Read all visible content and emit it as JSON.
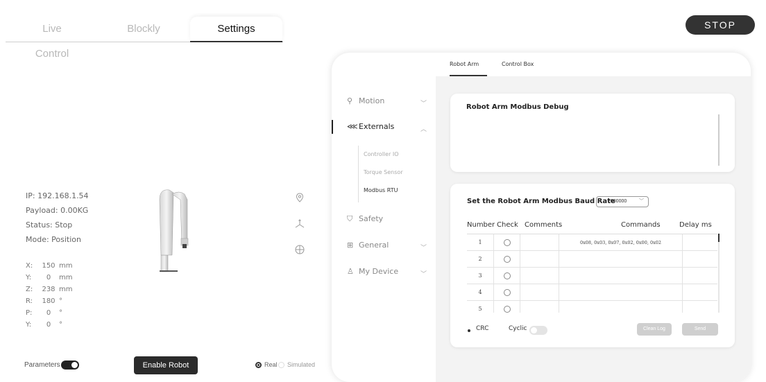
{
  "top_tabs": [
    {
      "label": "Live Control"
    },
    {
      "label": "Blockly"
    },
    {
      "label": "Settings"
    }
  ],
  "stop_label": "STOP",
  "robot_info": {
    "ip": "IP: 192.168.1.54",
    "payload": "Payload: 0.00KG",
    "status": "Status: Stop",
    "mode": "Mode: Position"
  },
  "coords": [
    {
      "axis": "X:",
      "value": "150",
      "unit": "mm"
    },
    {
      "axis": "Y:",
      "value": "0",
      "unit": "mm"
    },
    {
      "axis": "Z:",
      "value": "238",
      "unit": "mm"
    },
    {
      "axis": "R:",
      "value": "180",
      "unit": "°"
    },
    {
      "axis": "P:",
      "value": "0",
      "unit": "°"
    },
    {
      "axis": "Y:",
      "value": "0",
      "unit": "°"
    }
  ],
  "parameters_label": "Parameters",
  "enable_robot_label": "Enable Robot",
  "mode_options": {
    "real": "Real",
    "simulated": "Simulated"
  },
  "settings": {
    "sub_tabs": [
      {
        "label": "Robot Arm"
      },
      {
        "label": "Control Box"
      }
    ],
    "nav": [
      {
        "label": "Motion"
      },
      {
        "label": "Externals"
      },
      {
        "label": "Safety"
      },
      {
        "label": "General"
      },
      {
        "label": "My Device"
      }
    ],
    "externals_sub": [
      {
        "label": "Controller IO"
      },
      {
        "label": "Torque Sensor"
      },
      {
        "label": "Modbus RTU"
      }
    ]
  },
  "debug_panel": {
    "title": "Robot Arm Modbus Debug"
  },
  "baud_panel": {
    "title": "Set the Robot Arm Modbus Baud Rate",
    "baud_value": "2000000",
    "headers": {
      "number": "Number",
      "check": "Check",
      "comments": "Comments",
      "commands": "Commands",
      "delay": "Delay ms"
    },
    "rows": [
      {
        "number": "1",
        "command": "0x08, 0x03, 0x07, 0x02, 0x00, 0x02"
      },
      {
        "number": "2",
        "command": ""
      },
      {
        "number": "3",
        "command": ""
      },
      {
        "number": "4",
        "command": ""
      },
      {
        "number": "5",
        "command": ""
      }
    ],
    "crc_label": "CRC",
    "cyclic_label": "Cyclic",
    "clean_log_label": "Clean Log",
    "send_label": "Send"
  }
}
